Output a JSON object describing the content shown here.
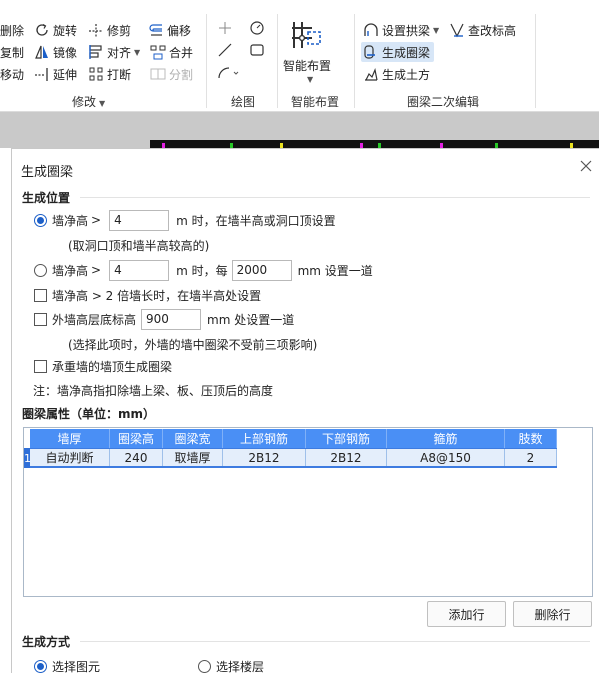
{
  "ribbon": {
    "modify": {
      "items": {
        "delete": "删除",
        "rotate": "旋转",
        "trim": "修剪",
        "offset": "偏移",
        "copy": "复制",
        "mirror": "镜像",
        "align": "对齐",
        "merge": "合并",
        "move": "移动",
        "extend": "延伸",
        "break": "打断",
        "split": "分割"
      },
      "label": "修改"
    },
    "draw": {
      "label": "绘图"
    },
    "smart": {
      "button": "智能布置",
      "label": "智能布置"
    },
    "ringbeam": {
      "items": {
        "set_arch": "设置拱梁",
        "check_elev": "查改标高",
        "gen_ringbeam": "生成圈梁",
        "gen_earth": "生成土方"
      },
      "label": "圈梁二次编辑"
    }
  },
  "dialog": {
    "title": "生成圈梁",
    "position_section": "生成位置",
    "opt1": {
      "prefix": "墙净高",
      "gt": ">",
      "value": "4",
      "suffix": "m 时，在墙半高或洞口顶设置"
    },
    "opt1_note": "(取洞口顶和墙半高较高的)",
    "opt2": {
      "prefix": "墙净高",
      "gt": ">",
      "value": "4",
      "mid": "m 时，每",
      "value2": "2000",
      "suffix": "mm 设置一道"
    },
    "opt3": "墙净高 > 2 倍墙长时，在墙半高处设置",
    "opt4": {
      "prefix": "外墙高层底标高",
      "value": "900",
      "suffix": "mm 处设置一道"
    },
    "opt4_note": "(选择此项时，外墙的墙中圈梁不受前三项影响)",
    "opt5": "承重墙的墙顶生成圈梁",
    "note": "注：墙净高指扣除墙上梁、板、压顶后的高度",
    "props_section": "圈梁属性（单位：mm）",
    "table": {
      "headers": [
        "墙厚",
        "圈梁高",
        "圈梁宽",
        "上部钢筋",
        "下部钢筋",
        "箍筋",
        "肢数"
      ],
      "row_index": "1",
      "rows": [
        [
          "自动判断",
          "240",
          "取墙厚",
          "2B12",
          "2B12",
          "A8@150",
          "2"
        ]
      ]
    },
    "add_row": "添加行",
    "delete_row": "删除行",
    "method_section": "生成方式",
    "method_select": "选择图元",
    "method_floor": "选择楼层"
  }
}
